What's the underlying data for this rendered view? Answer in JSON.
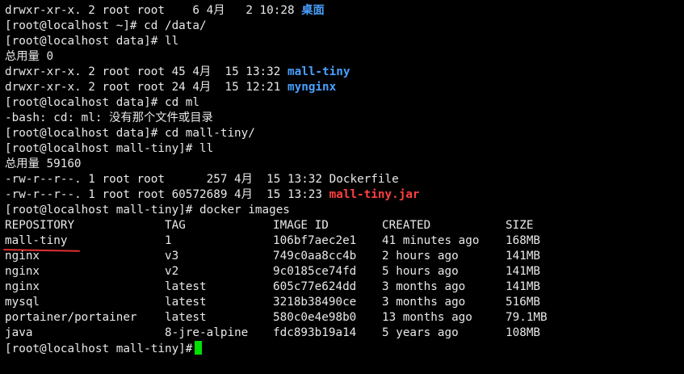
{
  "lines": [
    {
      "pre": "drwxr-xr-x. 2 root root    6 4月   2 10:28 ",
      "name": "桌面",
      "type": "dir"
    },
    {
      "text": "[root@localhost ~]# cd /data/"
    },
    {
      "text": "[root@localhost data]# ll"
    },
    {
      "text": "总用量 0"
    },
    {
      "pre": "drwxr-xr-x. 2 root root 45 4月  15 13:32 ",
      "name": "mall-tiny",
      "type": "dir"
    },
    {
      "pre": "drwxr-xr-x. 2 root root 24 4月  15 12:21 ",
      "name": "mynginx",
      "type": "dir"
    },
    {
      "text": "[root@localhost data]# cd ml"
    },
    {
      "text": "-bash: cd: ml: 没有那个文件或目录"
    },
    {
      "text": "[root@localhost data]# cd mall-tiny/"
    },
    {
      "text": "[root@localhost mall-tiny]# ll"
    },
    {
      "text": "总用量 59160"
    },
    {
      "pre": "-rw-r--r--. 1 root root      257 4月  15 13:32 ",
      "name": "Dockerfile",
      "type": "file"
    },
    {
      "pre": "-rw-r--r--. 1 root root 60572689 4月  15 13:23 ",
      "name": "mall-tiny.jar",
      "type": "pkg"
    },
    {
      "text": "[root@localhost mall-tiny]# docker images"
    }
  ],
  "images_table": {
    "headers": [
      "REPOSITORY",
      "TAG",
      "IMAGE ID",
      "CREATED",
      "SIZE"
    ],
    "rows": [
      [
        "mall-tiny",
        "1",
        "106bf7aec2e1",
        "41 minutes ago",
        "168MB"
      ],
      [
        "nginx",
        "v3",
        "749c0aa8cc4b",
        "2 hours ago",
        "141MB"
      ],
      [
        "nginx",
        "v2",
        "9c0185ce74fd",
        "5 hours ago",
        "141MB"
      ],
      [
        "nginx",
        "latest",
        "605c77e624dd",
        "3 months ago",
        "141MB"
      ],
      [
        "mysql",
        "latest",
        "3218b38490ce",
        "3 months ago",
        "516MB"
      ],
      [
        "portainer/portainer",
        "latest",
        "580c0e4e98b0",
        "13 months ago",
        "79.1MB"
      ],
      [
        "java",
        "8-jre-alpine",
        "fdc893b19a14",
        "5 years ago",
        "108MB"
      ]
    ]
  },
  "prompt": "[root@localhost mall-tiny]#",
  "colors": {
    "background": "#000000",
    "text": "#e8e8e8",
    "directory": "#4aa0ff",
    "archive": "#ff4040",
    "cursor": "#00e000",
    "annotation_underline": "#e03030"
  }
}
